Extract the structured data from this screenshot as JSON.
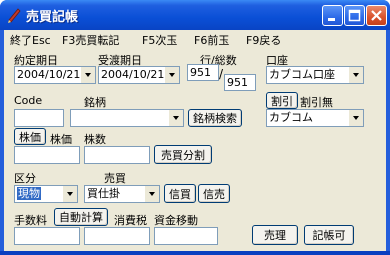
{
  "window": {
    "title": "売買記帳"
  },
  "menu": [
    {
      "label": "終了Esc"
    },
    {
      "label": "F3売買転記"
    },
    {
      "label": "F5次玉"
    },
    {
      "label": "F6前玉"
    },
    {
      "label": "F9戻る"
    }
  ],
  "labels": {
    "contract_date": "約定期日",
    "delivery_date": "受渡期日",
    "row_total": "行/総数",
    "account": "口座",
    "code": "Code",
    "issue": "銘柄",
    "discount": "割引",
    "no_discount": "割引無",
    "share_price_btn": "株価",
    "share_price": "株価",
    "share_count": "株数",
    "category": "区分",
    "trade": "売買",
    "fee": "手数料",
    "consumption_tax": "消費税",
    "fund_transfer": "資金移動"
  },
  "fields": {
    "contract_date": "2004/10/21",
    "delivery_date": "2004/10/21",
    "row": "951",
    "total": "951",
    "account": "カブコム口座",
    "code": "",
    "issue": "",
    "broker": "カブコム",
    "share_price": "",
    "share_count": "",
    "category": "現物",
    "trade": "買仕掛",
    "fee": "",
    "auto_calc_value": "",
    "consumption_tax": "",
    "fund_transfer": ""
  },
  "buttons": {
    "issue_search": "銘柄検索",
    "split": "売買分割",
    "credit_buy": "信買",
    "credit_sell": "信売",
    "auto_calc": "自動計算",
    "trade_ledger": "売理",
    "bookable": "記帳可"
  }
}
